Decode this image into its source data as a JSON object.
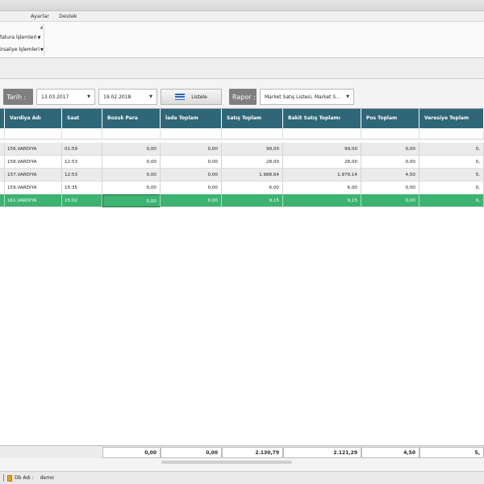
{
  "menu": [
    "Ayarlar",
    "Destek"
  ],
  "ribbon": {
    "buttons": [
      "fatura İşlemleri",
      "irsaliye İşlemleri"
    ]
  },
  "filter": {
    "tarih_label": "Tarih :",
    "date_from": "13.03.2017",
    "date_to": "19.02.2018",
    "list_button": "Listele",
    "rapor_label": "Rapor :",
    "rapor_value": "Market Satış Listesi, Market S..."
  },
  "grid": {
    "columns": [
      "Vardiya Adı",
      "Saat",
      "Bozuk Para",
      "İade Toplam",
      "Satış Toplam",
      "Bakit Satış Toplamı",
      "Pos Toplam",
      "Veresiye Toplam"
    ],
    "rows": [
      [
        "156.VARDIYA",
        "01:59",
        "0,00",
        "0,00",
        "99,00",
        "99,00",
        "0,00",
        "0,"
      ],
      [
        "158.VARDIYA",
        "12:53",
        "0,00",
        "0,00",
        "28,00",
        "28,00",
        "0,00",
        "0,"
      ],
      [
        "157.VARDIYA",
        "12:53",
        "0,00",
        "0,00",
        "1.988,64",
        "1.979,14",
        "4,50",
        "5,"
      ],
      [
        "159.VARDIYA",
        "15:35",
        "0,00",
        "0,00",
        "6,00",
        "6,00",
        "0,00",
        "0,"
      ],
      [
        "161.VARDIYA",
        "15:02",
        "0,00",
        "0,00",
        "9,15",
        "9,15",
        "0,00",
        "0,"
      ]
    ],
    "selected_row": 4,
    "totals": [
      "0,00",
      "0,00",
      "2.130,79",
      "2.121,29",
      "4,50",
      "5,"
    ]
  },
  "status": {
    "db_label": "Db Adı :",
    "db_value": "demo"
  }
}
